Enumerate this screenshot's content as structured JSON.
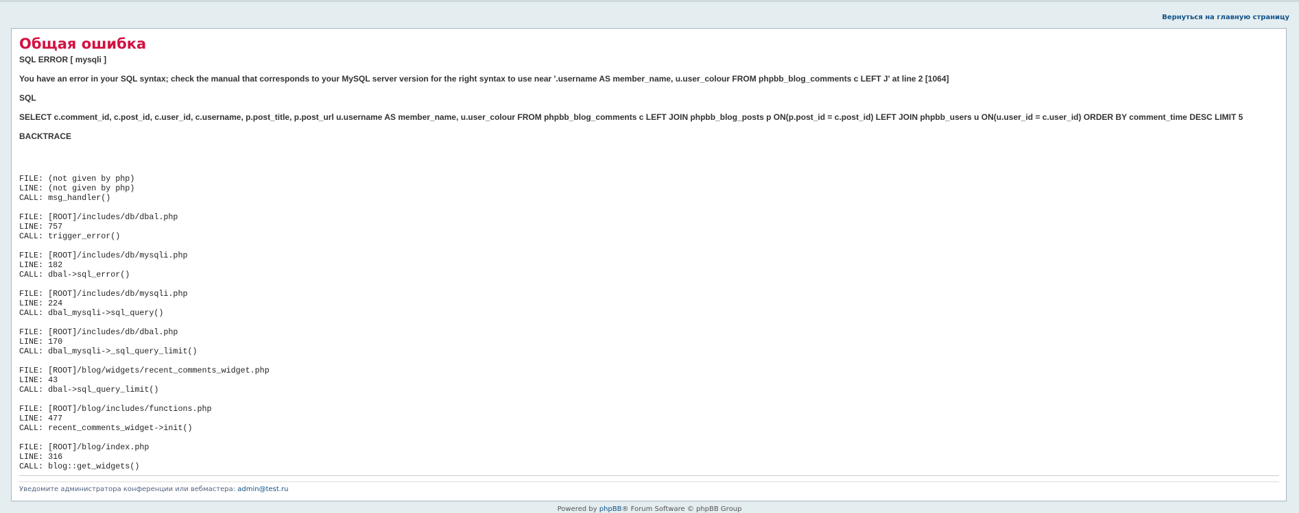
{
  "header": {
    "home_link": "Вернуться на главную страницу"
  },
  "error": {
    "title": "Общая ошибка",
    "sql_error_line": "SQL ERROR [ mysqli ]",
    "message": "You have an error in your SQL syntax; check the manual that corresponds to your MySQL server version for the right syntax to use near '.username AS member_name, u.user_colour FROM phpbb_blog_comments c LEFT J' at line 2 [1064]",
    "sql_label": "SQL",
    "sql_query": "SELECT c.comment_id, c.post_id, c.user_id, c.username, p.post_title, p.post_url u.username AS member_name, u.user_colour FROM phpbb_blog_comments c LEFT JOIN phpbb_blog_posts p ON(p.post_id = c.post_id) LEFT JOIN phpbb_users u ON(u.user_id = c.user_id) ORDER BY comment_time DESC LIMIT 5",
    "backtrace_label": "BACKTRACE"
  },
  "backtrace": [
    {
      "file": "FILE: (not given by php)",
      "line": "LINE: (not given by php)",
      "call": "CALL: msg_handler()"
    },
    {
      "file": "FILE: [ROOT]/includes/db/dbal.php",
      "line": "LINE: 757",
      "call": "CALL: trigger_error()"
    },
    {
      "file": "FILE: [ROOT]/includes/db/mysqli.php",
      "line": "LINE: 182",
      "call": "CALL: dbal->sql_error()"
    },
    {
      "file": "FILE: [ROOT]/includes/db/mysqli.php",
      "line": "LINE: 224",
      "call": "CALL: dbal_mysqli->sql_query()"
    },
    {
      "file": "FILE: [ROOT]/includes/db/dbal.php",
      "line": "LINE: 170",
      "call": "CALL: dbal_mysqli->_sql_query_limit()"
    },
    {
      "file": "FILE: [ROOT]/blog/widgets/recent_comments_widget.php",
      "line": "LINE: 43",
      "call": "CALL: dbal->sql_query_limit()"
    },
    {
      "file": "FILE: [ROOT]/blog/includes/functions.php",
      "line": "LINE: 477",
      "call": "CALL: recent_comments_widget->init()"
    },
    {
      "file": "FILE: [ROOT]/blog/index.php",
      "line": "LINE: 316",
      "call": "CALL: blog::get_widgets()"
    }
  ],
  "notice": {
    "text": "Уведомите администратора конференции или вебмастера: ",
    "email": "admin@test.ru"
  },
  "footer": {
    "prefix": "Powered by ",
    "phpbb_link": "phpBB",
    "suffix": "® Forum Software © phpBB Group"
  },
  "colors": {
    "page_background": "#e4edf0",
    "title_red": "#d31141",
    "link_blue": "#105289"
  }
}
